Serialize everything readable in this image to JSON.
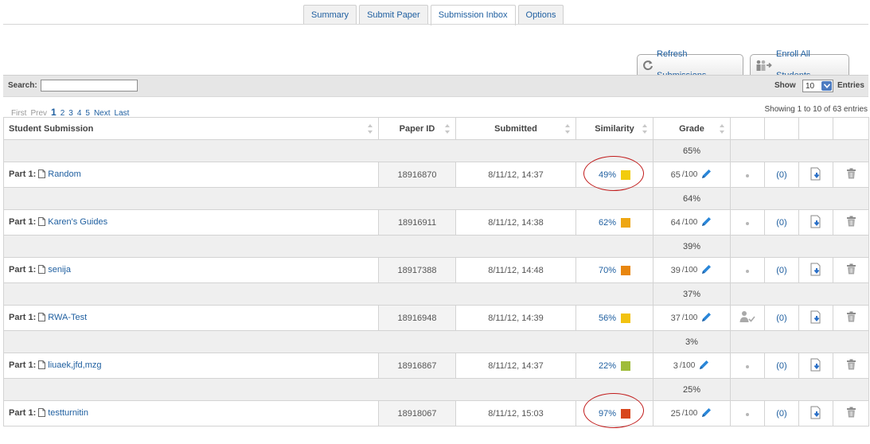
{
  "tabs": [
    {
      "label": "Summary",
      "active": false
    },
    {
      "label": "Submit Paper",
      "active": false
    },
    {
      "label": "Submission Inbox",
      "active": true
    },
    {
      "label": "Options",
      "active": false
    }
  ],
  "actions": {
    "refresh_label": "Refresh Submissions",
    "enroll_label": "Enroll All Students"
  },
  "search": {
    "label": "Search:",
    "value": ""
  },
  "entries": {
    "show_label": "Show",
    "value": "10",
    "entries_label": "Entries"
  },
  "pagination": {
    "first": "First",
    "prev": "Prev",
    "pages": [
      "1",
      "2",
      "3",
      "4",
      "5"
    ],
    "current": "1",
    "next": "Next",
    "last": "Last"
  },
  "showing": "Showing 1 to 10 of 63 entries",
  "columns": {
    "student": "Student Submission",
    "paper_id": "Paper ID",
    "submitted": "Submitted",
    "similarity": "Similarity",
    "grade": "Grade"
  },
  "part_label": "Part 1:",
  "grade_out_of": "/100",
  "rows": [
    {
      "grade_pct": "65%",
      "title": "Random",
      "paper_id": "18916870",
      "submitted": "8/11/12, 14:37",
      "similarity": "49%",
      "sim_color": "#f2cc0c",
      "grade": "65",
      "comments": "(0)",
      "graded_icon": false,
      "circled": true
    },
    {
      "grade_pct": "64%",
      "title": "Karen's Guides",
      "paper_id": "18916911",
      "submitted": "8/11/12, 14:38",
      "similarity": "62%",
      "sim_color": "#eea612",
      "grade": "64",
      "comments": "(0)",
      "graded_icon": false,
      "circled": false
    },
    {
      "grade_pct": "39%",
      "title": "senija",
      "paper_id": "18917388",
      "submitted": "8/11/12, 14:48",
      "similarity": "70%",
      "sim_color": "#e8860f",
      "grade": "39",
      "comments": "(0)",
      "graded_icon": false,
      "circled": false
    },
    {
      "grade_pct": "37%",
      "title": "RWA-Test",
      "paper_id": "18916948",
      "submitted": "8/11/12, 14:39",
      "similarity": "56%",
      "sim_color": "#f2c210",
      "grade": "37",
      "comments": "(0)",
      "graded_icon": true,
      "circled": false
    },
    {
      "grade_pct": "3%",
      "title": "liuaek,jfd,mzg",
      "paper_id": "18916867",
      "submitted": "8/11/12, 14:37",
      "similarity": "22%",
      "sim_color": "#9fbc3a",
      "grade": "3",
      "comments": "(0)",
      "graded_icon": false,
      "circled": false
    },
    {
      "grade_pct": "25%",
      "title": "testturnitin",
      "paper_id": "18918067",
      "submitted": "8/11/12, 15:03",
      "similarity": "97%",
      "sim_color": "#d8461c",
      "grade": "25",
      "comments": "(0)",
      "graded_icon": false,
      "circled": true
    }
  ]
}
